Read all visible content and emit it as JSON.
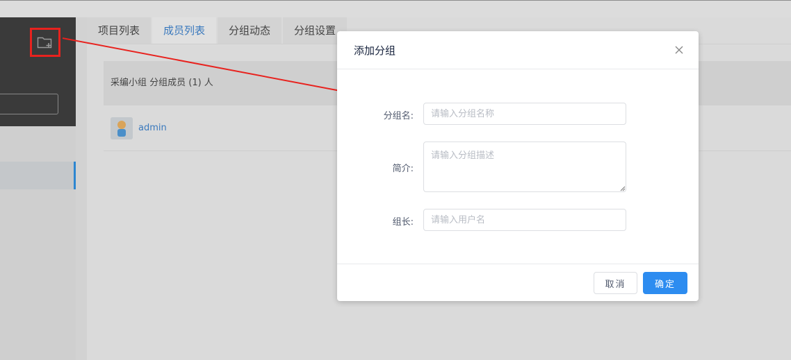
{
  "tabs": [
    "项目列表",
    "成员列表",
    "分组动态",
    "分组设置"
  ],
  "active_tab": "成员列表",
  "group_header": "采编小组 分组成员 (1) 人",
  "members": [
    {
      "name": "admin"
    }
  ],
  "modal": {
    "title": "添加分组",
    "fields": {
      "name": {
        "label": "分组名:",
        "placeholder": "请输入分组名称",
        "value": ""
      },
      "intro": {
        "label": "简介:",
        "placeholder": "请输入分组描述",
        "value": ""
      },
      "leader": {
        "label": "组长:",
        "placeholder": "请输入用户名",
        "value": ""
      }
    },
    "cancel_label": "取消",
    "ok_label": "确定"
  },
  "icons": {
    "add_folder": "folder-plus-icon",
    "close": "close-icon"
  },
  "colors": {
    "primary": "#2d8cf0",
    "highlight": "#e8221e",
    "link": "#3a79bd"
  }
}
